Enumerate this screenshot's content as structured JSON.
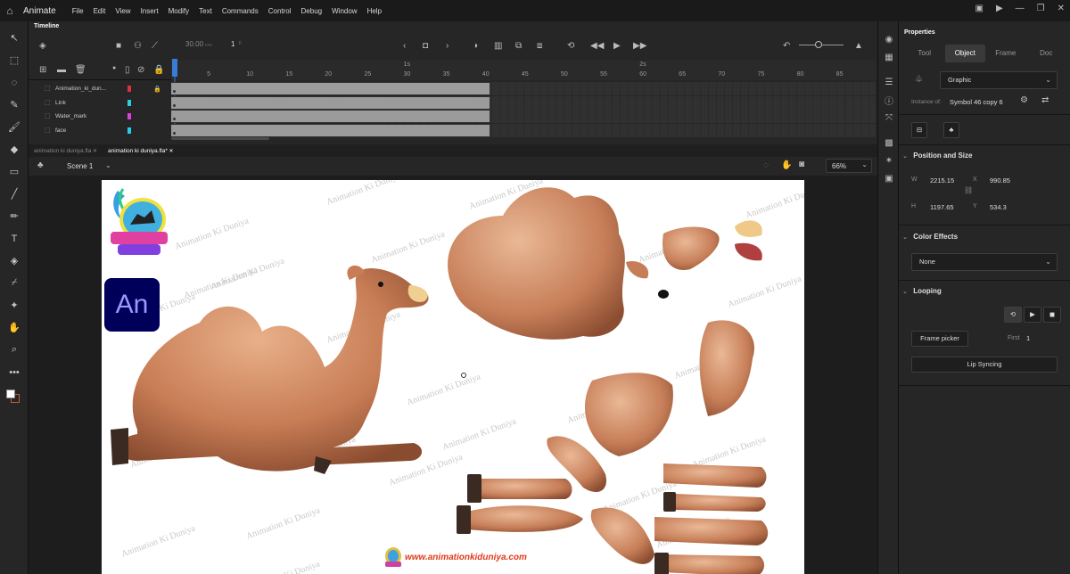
{
  "app": {
    "name": "Animate"
  },
  "menu": [
    "File",
    "Edit",
    "View",
    "Insert",
    "Modify",
    "Text",
    "Commands",
    "Control",
    "Debug",
    "Window",
    "Help"
  ],
  "timeline": {
    "title": "Timeline",
    "fps": "30.00",
    "fps_unit": "FPS",
    "frame": "1",
    "frame_unit": "F",
    "ruler_marks": [
      "5",
      "10",
      "15",
      "20",
      "25",
      "30",
      "35",
      "40",
      "45",
      "50",
      "55",
      "60",
      "65",
      "70",
      "75",
      "80",
      "85"
    ],
    "second_marks": [
      "1s",
      "2s"
    ],
    "layers": [
      {
        "name": "Animation_ki_dun...",
        "color": "#e0303a",
        "locked": true
      },
      {
        "name": "Link",
        "color": "#2ad0e0",
        "locked": false
      },
      {
        "name": "Water_mark",
        "color": "#e040e0",
        "locked": false
      },
      {
        "name": "face",
        "color": "#20d0e8",
        "locked": false
      }
    ]
  },
  "doc_tabs": [
    {
      "label": "animation ki duniya.fla",
      "active": false
    },
    {
      "label": "animation ki duniya.fla*",
      "active": true
    }
  ],
  "scene": {
    "label": "Scene 1",
    "zoom": "66%"
  },
  "stage": {
    "watermark_text": "Animation Ki Duniya",
    "logo_text": "An",
    "site_url": "www.animationkiduniya.com"
  },
  "properties": {
    "title": "Properties",
    "tabs": [
      {
        "label": "Tool",
        "active": false
      },
      {
        "label": "Object",
        "active": true
      },
      {
        "label": "Frame",
        "active": false
      },
      {
        "label": "Doc",
        "active": false
      }
    ],
    "symbol_type": "Graphic",
    "instance_label": "Instance of:",
    "instance_name": "Symbol 46 copy 6",
    "position_size": {
      "title": "Position and Size",
      "w_label": "W",
      "w": "2215.15",
      "x_label": "X",
      "x": "990.85",
      "h_label": "H",
      "h": "1197.65",
      "y_label": "Y",
      "y": "534.3"
    },
    "color_effects": {
      "title": "Color Effects",
      "value": "None"
    },
    "looping": {
      "title": "Looping",
      "frame_picker": "Frame picker",
      "first_label": "First",
      "first": "1",
      "lip_syncing": "Lip Syncing"
    }
  }
}
